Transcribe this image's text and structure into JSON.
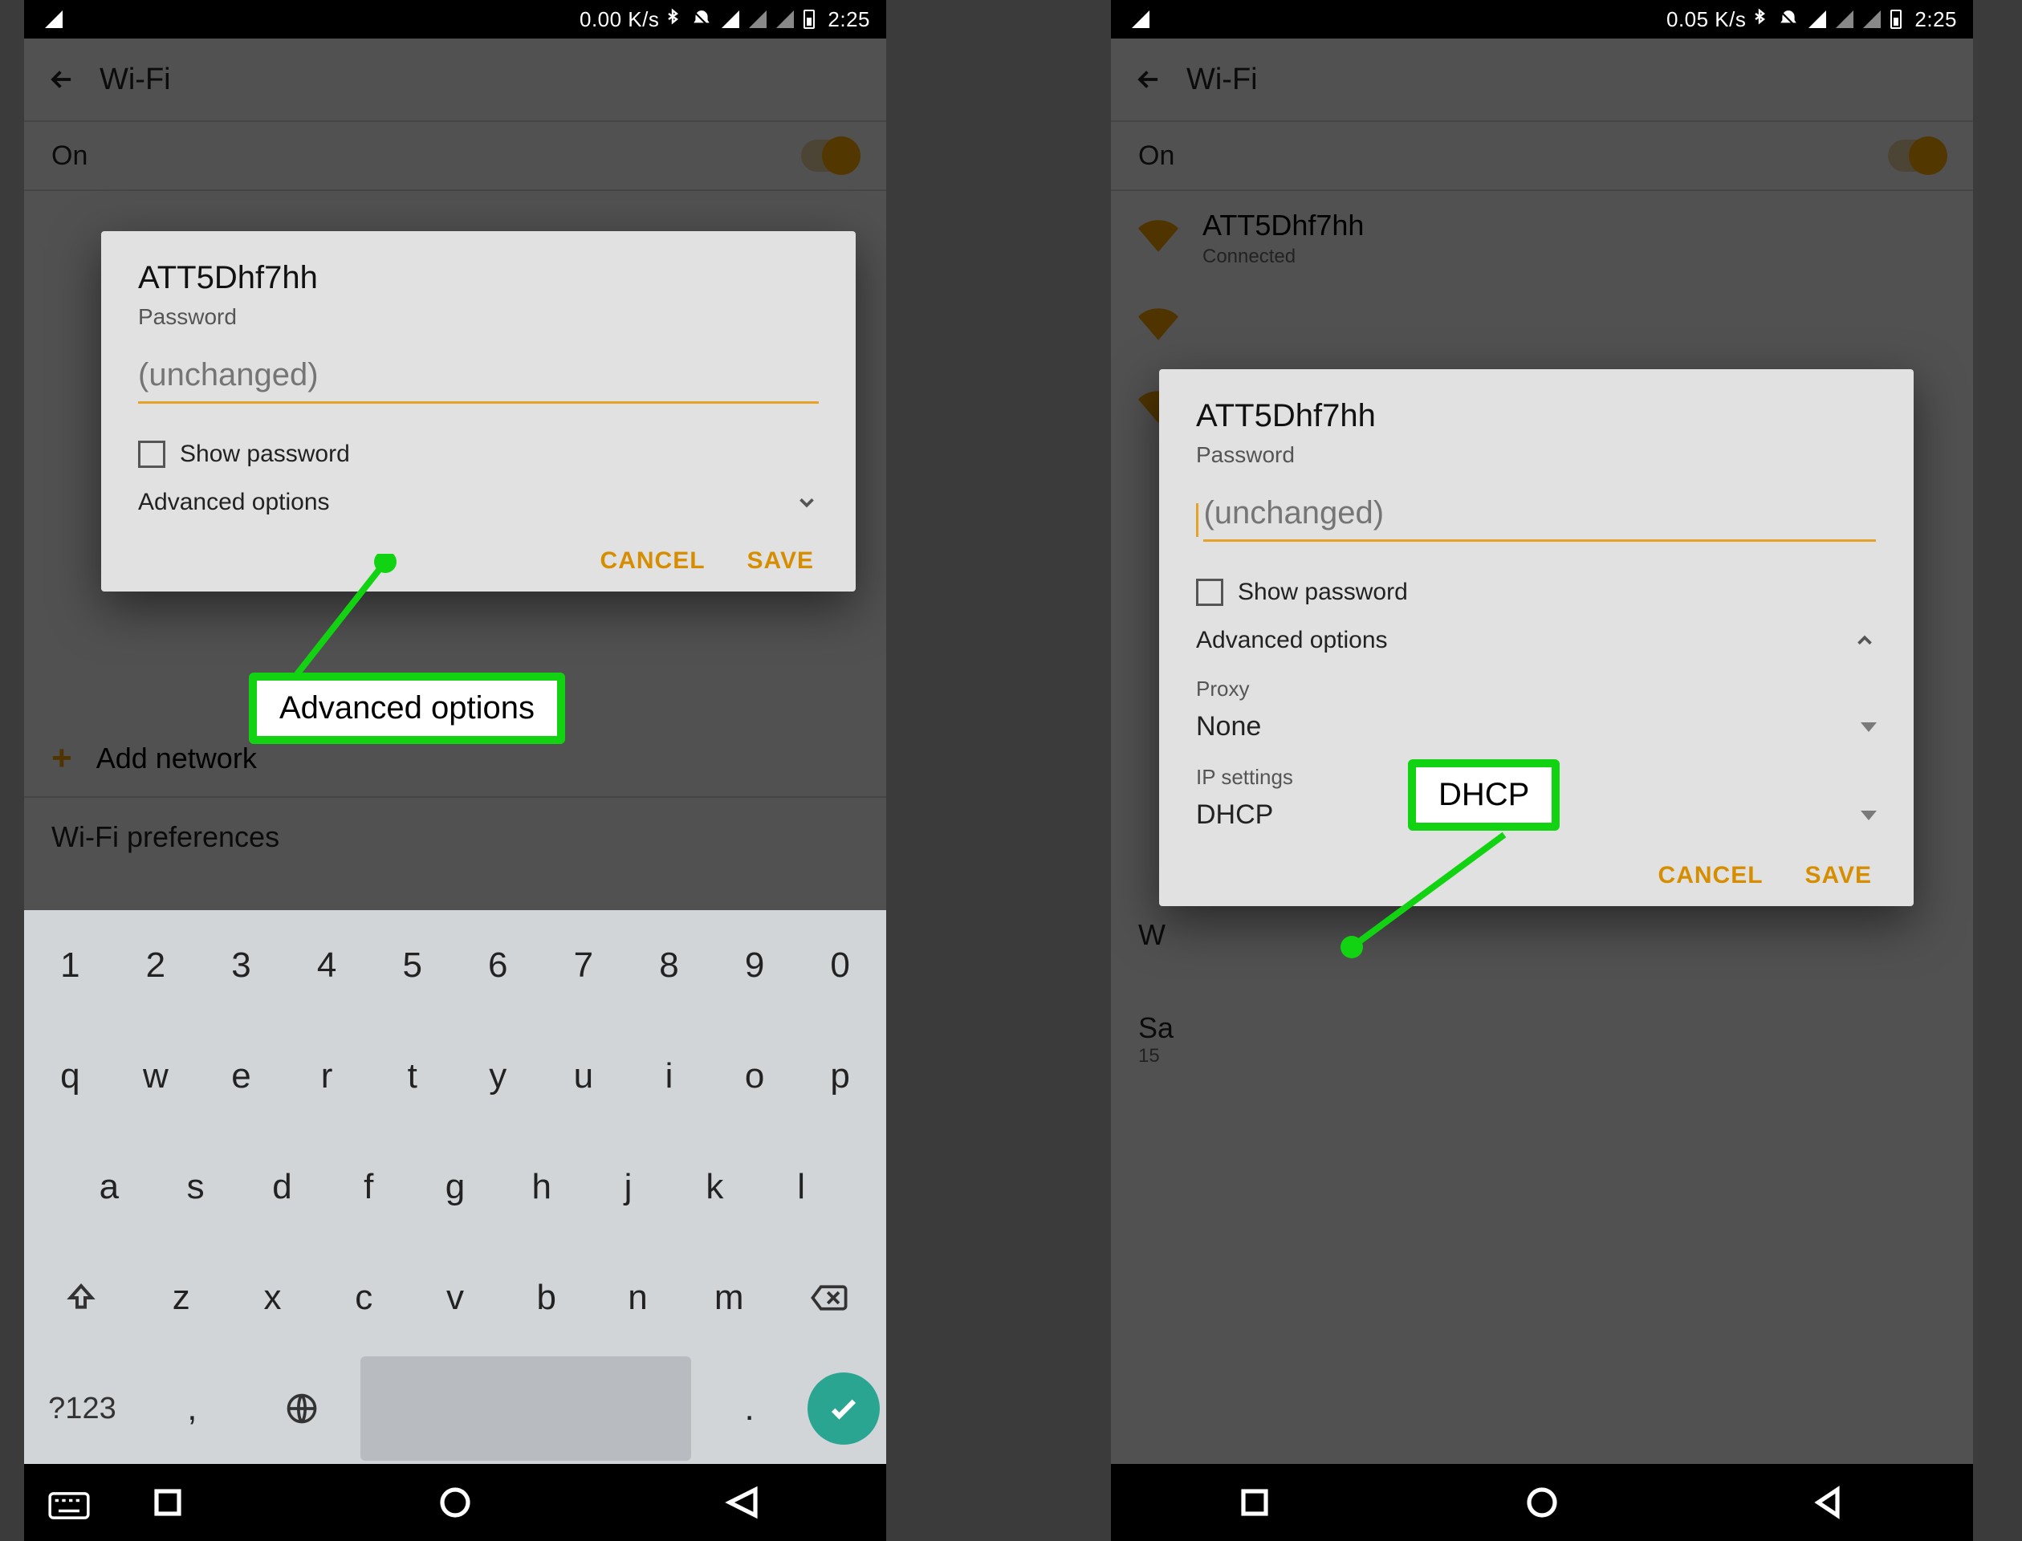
{
  "left": {
    "status": {
      "rate": "0.00 K/s",
      "time": "2:25"
    },
    "appbar_title": "Wi-Fi",
    "toggle_label": "On",
    "dialog": {
      "ssid": "ATT5Dhf7hh",
      "pw_label": "Password",
      "pw_placeholder": "(unchanged)",
      "show_pw": "Show password",
      "advanced": "Advanced options",
      "cancel": "CANCEL",
      "save": "SAVE"
    },
    "add_network": "Add network",
    "prefs": "Wi-Fi preferences",
    "callout": "Advanced options",
    "keyboard": {
      "r1": [
        "1",
        "2",
        "3",
        "4",
        "5",
        "6",
        "7",
        "8",
        "9",
        "0"
      ],
      "r2": [
        "q",
        "w",
        "e",
        "r",
        "t",
        "y",
        "u",
        "i",
        "o",
        "p"
      ],
      "r3": [
        "a",
        "s",
        "d",
        "f",
        "g",
        "h",
        "j",
        "k",
        "l"
      ],
      "r4": [
        "z",
        "x",
        "c",
        "v",
        "b",
        "n",
        "m"
      ],
      "sym": "?123",
      "comma": ",",
      "period": "."
    }
  },
  "right": {
    "status": {
      "rate": "0.05 K/s",
      "time": "2:25"
    },
    "appbar_title": "Wi-Fi",
    "toggle_label": "On",
    "connected_net": {
      "ssid": "ATT5Dhf7hh",
      "sub": "Connected"
    },
    "pref_line": "W",
    "saved_line": "Sa",
    "saved_sub": "15",
    "dialog": {
      "ssid": "ATT5Dhf7hh",
      "pw_label": "Password",
      "pw_placeholder": "(unchanged)",
      "show_pw": "Show password",
      "advanced": "Advanced options",
      "proxy_label": "Proxy",
      "proxy_value": "None",
      "ip_label": "IP settings",
      "ip_value": "DHCP",
      "cancel": "CANCEL",
      "save": "SAVE"
    },
    "callout": "DHCP"
  }
}
